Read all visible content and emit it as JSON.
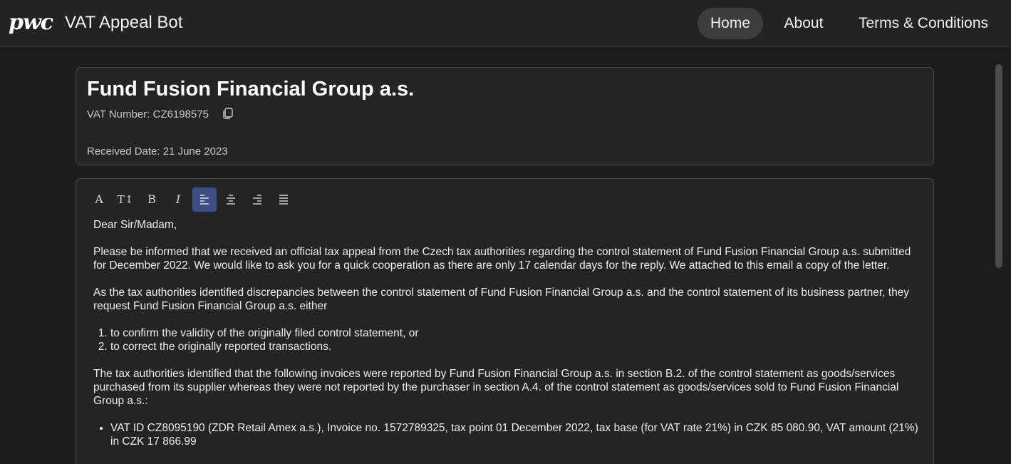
{
  "header": {
    "logo_text": "pwc",
    "app_title": "VAT Appeal Bot",
    "nav": {
      "home": "Home",
      "about": "About",
      "terms": "Terms & Conditions"
    }
  },
  "info_card": {
    "company_name": "Fund Fusion Financial Group a.s.",
    "vat_number": "VAT Number: CZ6198575",
    "received_date": "Received Date: 21 June 2023"
  },
  "toolbar": {
    "font_icon": "A",
    "font_size_icon": "T↕",
    "bold_icon": "B",
    "italic_icon": "I",
    "align_active": "align-left"
  },
  "letter": {
    "greeting": "Dear Sir/Madam,",
    "para1": "Please be informed that we received an official tax appeal from the Czech tax authorities regarding the control statement of Fund Fusion Financial Group a.s. submitted for December 2022. We would like to ask you for a quick cooperation as there are only 17 calendar days for the reply. We attached to this email a copy of the letter.",
    "para2": "As the tax authorities identified discrepancies between the control statement of Fund Fusion Financial Group a.s. and the control statement of its business partner, they request Fund Fusion Financial Group a.s. either",
    "options": [
      "to confirm the validity of the originally filed control statement, or",
      "to correct the originally reported transactions."
    ],
    "para3": "The tax authorities identified that the following invoices were reported by Fund Fusion Financial Group a.s. in section B.2. of the control statement as goods/services purchased from its supplier whereas they were not reported by the purchaser in section A.4. of the control statement as goods/services sold to Fund Fusion Financial Group a.s.:",
    "invoices": [
      "VAT ID CZ8095190 (ZDR Retail Amex a.s.), Invoice no. 1572789325, tax point 01 December 2022, tax base (for VAT rate 21%) in CZK 85 080.90, VAT amount (21%) in CZK 17 866.99"
    ]
  },
  "colors": {
    "background": "#1b1b1b",
    "header_bg": "#232323",
    "card_bg": "#242424",
    "active_nav": "#3d3d3d",
    "active_tool": "#3e4f86"
  }
}
